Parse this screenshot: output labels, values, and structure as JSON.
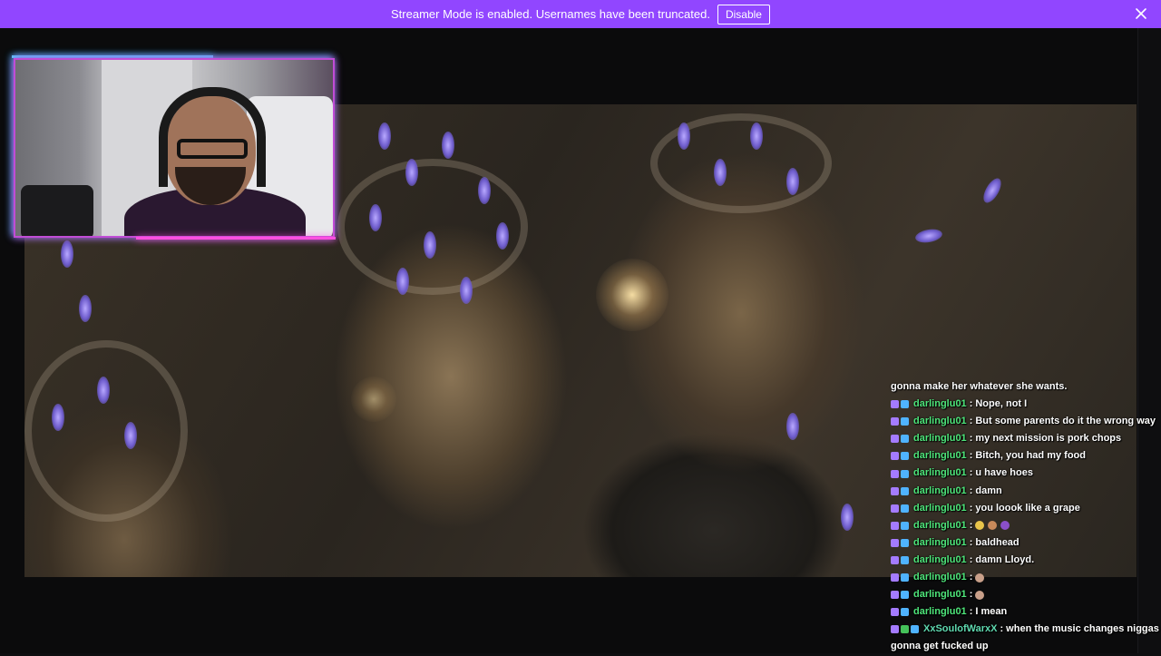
{
  "banner": {
    "message": "Streamer Mode is enabled. Usernames have been truncated.",
    "disable_label": "Disable",
    "close_icon": "close-icon",
    "color": "#9146ff"
  },
  "chat": {
    "lines": [
      {
        "type": "continuation",
        "text": "gonna make her whatever she wants."
      },
      {
        "type": "message",
        "user": "darlinglu01",
        "text": "Nope, not I"
      },
      {
        "type": "message",
        "user": "darlinglu01",
        "text": "But some parents do it the wrong way"
      },
      {
        "type": "message",
        "user": "darlinglu01",
        "text": "my next mission is pork chops"
      },
      {
        "type": "message",
        "user": "darlinglu01",
        "text": "Bitch, you had my food"
      },
      {
        "type": "message",
        "user": "darlinglu01",
        "text": "u have hoes"
      },
      {
        "type": "message",
        "user": "darlinglu01",
        "text": "damn"
      },
      {
        "type": "message",
        "user": "darlinglu01",
        "text": "you loook like a grape"
      },
      {
        "type": "message",
        "user": "darlinglu01",
        "text": "",
        "emotes": [
          "#e8c44a",
          "#c98a5a",
          "#8a4fc9"
        ]
      },
      {
        "type": "message",
        "user": "darlinglu01",
        "text": "baldhead"
      },
      {
        "type": "message",
        "user": "darlinglu01",
        "text": "damn Lloyd."
      },
      {
        "type": "message",
        "user": "darlinglu01",
        "text": "",
        "emotes": [
          "#c9a08a"
        ]
      },
      {
        "type": "message",
        "user": "darlinglu01",
        "text": "",
        "emotes": [
          "#c9a08a"
        ]
      },
      {
        "type": "message",
        "user": "darlinglu01",
        "text": "I mean"
      },
      {
        "type": "message",
        "user": "XxSoulofWarxX",
        "text": "when the music changes niggas",
        "alt": true,
        "mod": true
      },
      {
        "type": "continuation",
        "text": "gonna get fucked up"
      }
    ]
  }
}
